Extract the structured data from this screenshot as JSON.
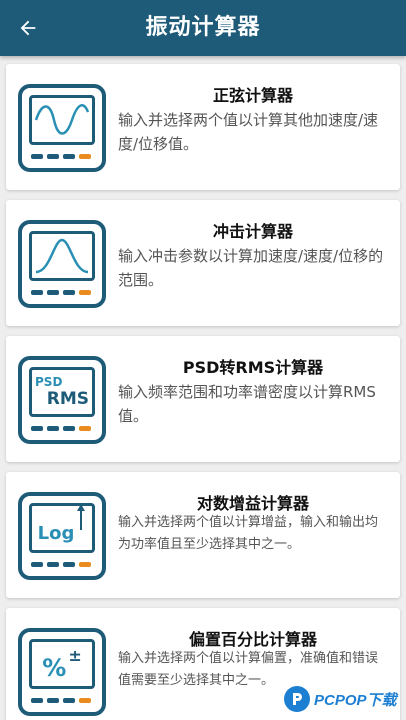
{
  "appbar": {
    "title": "振动计算器",
    "back_icon": "arrow-left-icon"
  },
  "colors": {
    "primary": "#1d5b79",
    "key_dark": "#1d5b79",
    "key_accent": "#e98b1f",
    "background": "#eeeeee"
  },
  "calculators": [
    {
      "title": "正弦计算器",
      "description": "输入并选择两个值以计算其他加速度/速度/位移值。",
      "icon": "sine-wave-icon"
    },
    {
      "title": "冲击计算器",
      "description": "输入冲击参数以计算加速度/速度/位移的范围。",
      "icon": "shock-pulse-icon"
    },
    {
      "title": "PSD转RMS计算器",
      "description": "输入频率范围和功率谱密度以计算RMS值。",
      "icon": "psd-rms-icon",
      "icon_text_top": "PSD",
      "icon_text_bottom": "RMS"
    },
    {
      "title": "对数增益计算器",
      "description": "输入并选择两个值以计算增益，输入和输出均为功率值且至少选择其中之一。",
      "icon": "log-gain-icon",
      "icon_text": "Log"
    },
    {
      "title": "偏置百分比计算器",
      "description": "输入并选择两个值以计算偏置，准确值和错误值需要至少选择其中之一。",
      "icon": "percent-offset-icon",
      "icon_text": "%",
      "icon_sign": "±"
    }
  ],
  "watermark": {
    "text": "PCPOP下载"
  }
}
